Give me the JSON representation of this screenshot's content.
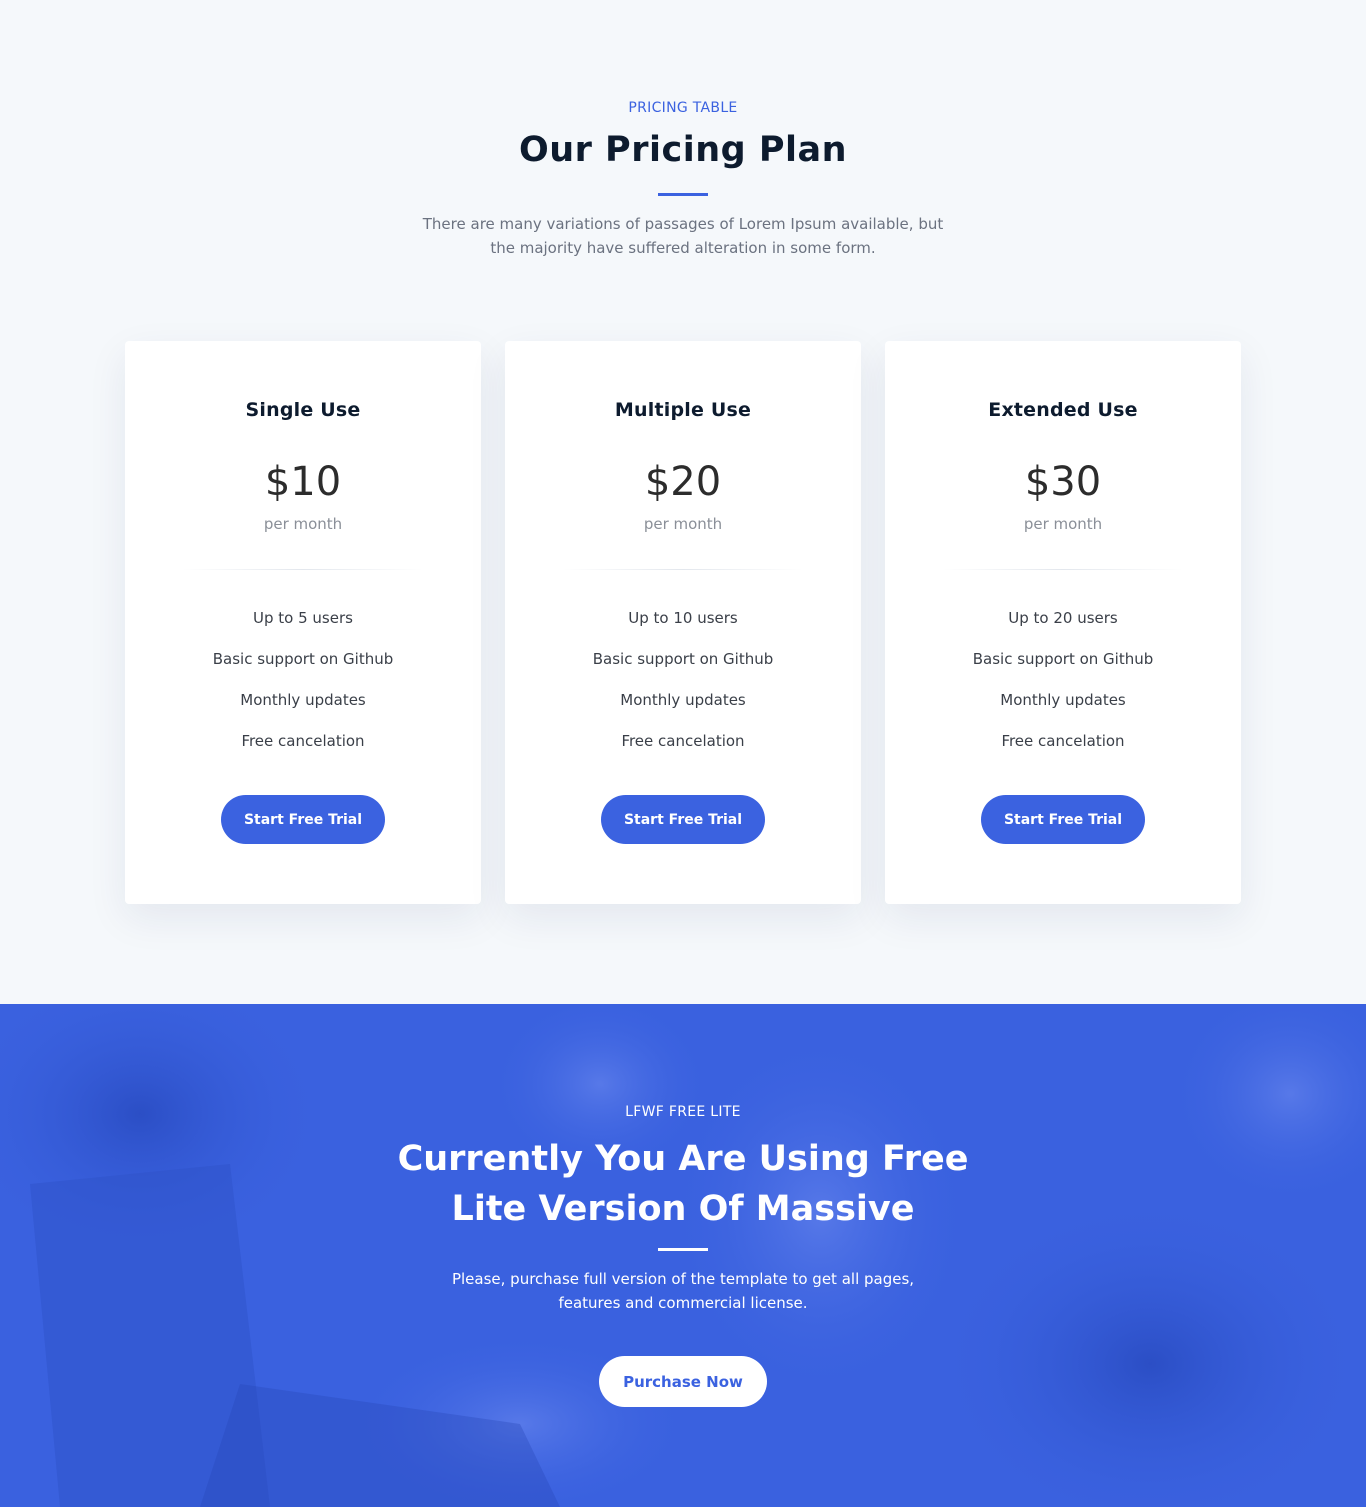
{
  "pricing": {
    "eyebrow": "PRICING TABLE",
    "title": "Our Pricing Plan",
    "description": "There are many variations of passages of Lorem Ipsum available, but the majority have suffered alteration in some form.",
    "plans": [
      {
        "name": "Single Use",
        "price": "$10",
        "period": "per month",
        "features": [
          "Up to 5 users",
          "Basic support on Github",
          "Monthly updates",
          "Free cancelation"
        ],
        "cta": "Start Free Trial"
      },
      {
        "name": "Multiple Use",
        "price": "$20",
        "period": "per month",
        "features": [
          "Up to 10 users",
          "Basic support on Github",
          "Monthly updates",
          "Free cancelation"
        ],
        "cta": "Start Free Trial"
      },
      {
        "name": "Extended Use",
        "price": "$30",
        "period": "per month",
        "features": [
          "Up to 20 users",
          "Basic support on Github",
          "Monthly updates",
          "Free cancelation"
        ],
        "cta": "Start Free Trial"
      }
    ]
  },
  "promo": {
    "eyebrow": "LFWF FREE LITE",
    "title": "Currently You Are Using Free Lite Version Of Massive",
    "description": "Please, purchase full version of the template to get all pages, features and commercial license.",
    "button": "Purchase Now"
  },
  "colors": {
    "accent": "#3b62e0",
    "page_background": "#f5f8fb",
    "card_background": "#ffffff",
    "heading": "#0d1b2e"
  }
}
